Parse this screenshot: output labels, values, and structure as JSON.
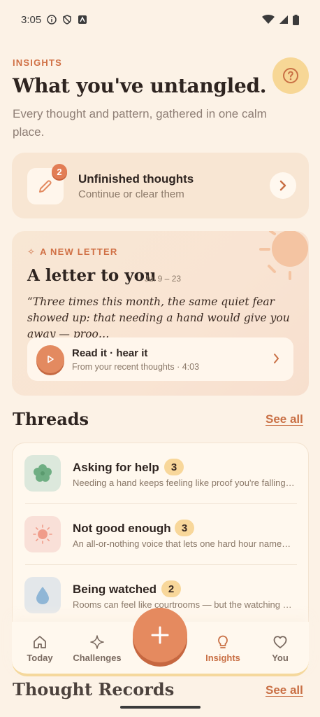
{
  "status_bar": {
    "time": "3:05"
  },
  "header": {
    "eyebrow": "INSIGHTS",
    "title": "What you've untangled.",
    "subtitle": "Every thought and pattern, gathered in one calm place."
  },
  "unfinished": {
    "count": "2",
    "title": "Unfinished thoughts",
    "subtitle": "Continue or clear them"
  },
  "letter": {
    "eyebrow": "A NEW LETTER",
    "title": "A letter to you",
    "date_range": "Jul 9 – 23",
    "quote": "“Three times this month, the same quiet fear showed up: that needing a hand would give you away — proo…",
    "read_title": "Read it · hear it",
    "read_subtitle": "From your recent thoughts · 4:03"
  },
  "threads": {
    "title": "Threads",
    "see_all": "See all",
    "items": [
      {
        "name": "Asking for help",
        "count": "3",
        "description": "Needing a hand keeps feeling like proof you're falling…",
        "icon": "flower-icon",
        "icon_bg": "#DCE8DC",
        "icon_color": "#6FAE83"
      },
      {
        "name": "Not good enough",
        "count": "3",
        "description": "An all-or-nothing voice that lets one hard hour name…",
        "icon": "sun-icon",
        "icon_bg": "#F9E0D8",
        "icon_color": "#F09C8A"
      },
      {
        "name": "Being watched",
        "count": "2",
        "description": "Rooms can feel like courtrooms — but the watching …",
        "icon": "drop-icon",
        "icon_bg": "#E3E7EA",
        "icon_color": "#8FB6D6"
      }
    ]
  },
  "nav": {
    "items": [
      {
        "label": "Today",
        "icon": "home-icon"
      },
      {
        "label": "Challenges",
        "icon": "sparkle-icon"
      },
      {
        "label": "Insights",
        "icon": "lightbulb-icon",
        "active": true
      },
      {
        "label": "You",
        "icon": "heart-icon"
      }
    ]
  },
  "records": {
    "title": "Thought Records",
    "see_all": "See all"
  },
  "colors": {
    "accent": "#E58A5F",
    "background": "#FCF2E6",
    "badge": "#F8D79A"
  }
}
